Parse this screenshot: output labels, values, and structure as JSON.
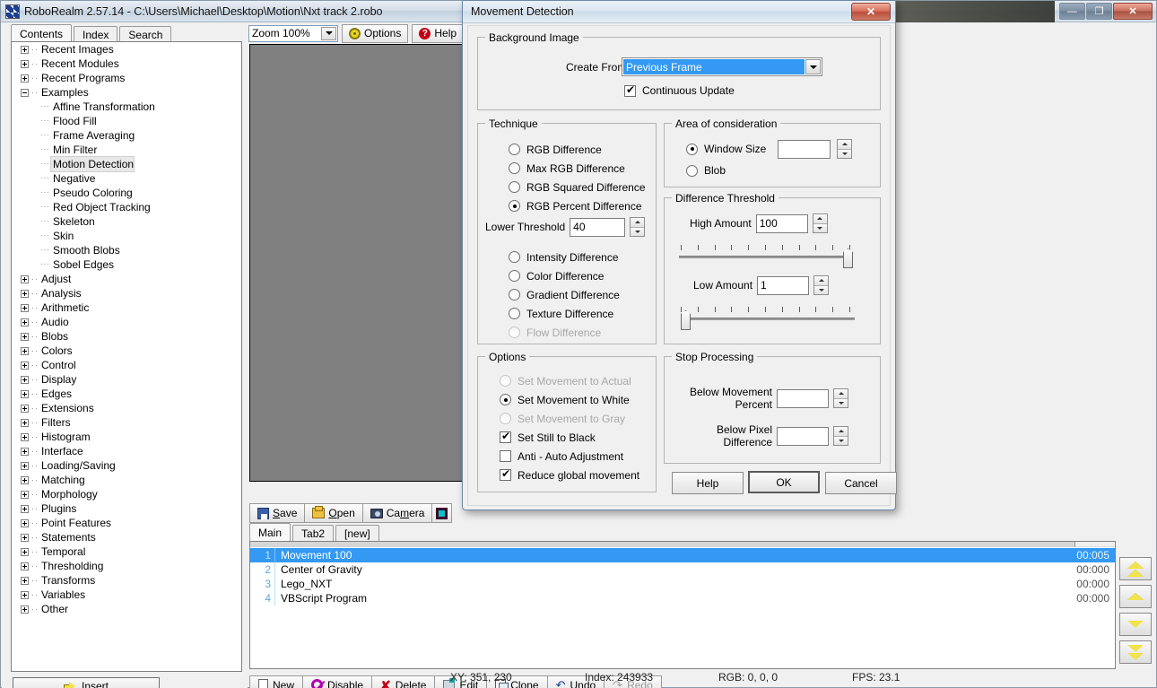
{
  "app": {
    "title": "RoboRealm 2.57.14 - C:\\Users\\Michael\\Desktop\\Motion\\Nxt track 2.robo",
    "window_controls": {
      "minimize": "—",
      "maximize": "❐",
      "close": "✕"
    }
  },
  "sidebar": {
    "tabs": [
      {
        "label": "Contents",
        "active": true
      },
      {
        "label": "Index",
        "active": false
      },
      {
        "label": "Search",
        "active": false
      }
    ],
    "tree": [
      {
        "label": "Recent Images",
        "type": "branch",
        "expanded": false
      },
      {
        "label": "Recent Modules",
        "type": "branch",
        "expanded": false
      },
      {
        "label": "Recent Programs",
        "type": "branch",
        "expanded": false
      },
      {
        "label": "Examples",
        "type": "branch",
        "expanded": true
      },
      {
        "label": "Affine Transformation",
        "type": "leaf"
      },
      {
        "label": "Flood Fill",
        "type": "leaf"
      },
      {
        "label": "Frame Averaging",
        "type": "leaf"
      },
      {
        "label": "Min Filter",
        "type": "leaf"
      },
      {
        "label": "Motion Detection",
        "type": "leaf",
        "selected": true
      },
      {
        "label": "Negative",
        "type": "leaf"
      },
      {
        "label": "Pseudo Coloring",
        "type": "leaf"
      },
      {
        "label": "Red Object Tracking",
        "type": "leaf"
      },
      {
        "label": "Skeleton",
        "type": "leaf"
      },
      {
        "label": "Skin",
        "type": "leaf"
      },
      {
        "label": "Smooth Blobs",
        "type": "leaf"
      },
      {
        "label": "Sobel Edges",
        "type": "leaf"
      },
      {
        "label": "Adjust",
        "type": "branch",
        "expanded": false
      },
      {
        "label": "Analysis",
        "type": "branch",
        "expanded": false
      },
      {
        "label": "Arithmetic",
        "type": "branch",
        "expanded": false
      },
      {
        "label": "Audio",
        "type": "branch",
        "expanded": false
      },
      {
        "label": "Blobs",
        "type": "branch",
        "expanded": false
      },
      {
        "label": "Colors",
        "type": "branch",
        "expanded": false
      },
      {
        "label": "Control",
        "type": "branch",
        "expanded": false
      },
      {
        "label": "Display",
        "type": "branch",
        "expanded": false
      },
      {
        "label": "Edges",
        "type": "branch",
        "expanded": false
      },
      {
        "label": "Extensions",
        "type": "branch",
        "expanded": false
      },
      {
        "label": "Filters",
        "type": "branch",
        "expanded": false
      },
      {
        "label": "Histogram",
        "type": "branch",
        "expanded": false
      },
      {
        "label": "Interface",
        "type": "branch",
        "expanded": false
      },
      {
        "label": "Loading/Saving",
        "type": "branch",
        "expanded": false
      },
      {
        "label": "Matching",
        "type": "branch",
        "expanded": false
      },
      {
        "label": "Morphology",
        "type": "branch",
        "expanded": false
      },
      {
        "label": "Plugins",
        "type": "branch",
        "expanded": false
      },
      {
        "label": "Point Features",
        "type": "branch",
        "expanded": false
      },
      {
        "label": "Statements",
        "type": "branch",
        "expanded": false
      },
      {
        "label": "Temporal",
        "type": "branch",
        "expanded": false
      },
      {
        "label": "Thresholding",
        "type": "branch",
        "expanded": false
      },
      {
        "label": "Transforms",
        "type": "branch",
        "expanded": false
      },
      {
        "label": "Variables",
        "type": "branch",
        "expanded": false
      },
      {
        "label": "Other",
        "type": "branch",
        "expanded": false
      }
    ],
    "insert_button": "Insert"
  },
  "viewer_toolbar": {
    "zoom_value": "Zoom 100%",
    "options_label": "Options",
    "help_label": "Help"
  },
  "file_toolbar": {
    "buttons": [
      {
        "label": "Save",
        "accel": "S"
      },
      {
        "label": "Open",
        "accel": "O"
      },
      {
        "label": "Camera",
        "accel": "m"
      }
    ]
  },
  "pipeline": {
    "tabs": [
      {
        "label": "Main",
        "active": true
      },
      {
        "label": "Tab2",
        "active": false
      },
      {
        "label": "[new]",
        "active": false
      }
    ],
    "rows": [
      {
        "index": "1",
        "name": "Movement 100",
        "time": "00:005",
        "selected": true
      },
      {
        "index": "2",
        "name": "Center of Gravity",
        "time": "00:000",
        "selected": false
      },
      {
        "index": "3",
        "name": "Lego_NXT",
        "time": "00:000",
        "selected": false
      },
      {
        "index": "4",
        "name": "VBScript Program",
        "time": "00:000",
        "selected": false
      }
    ],
    "scroll_buttons": [
      "move-to-top",
      "move-up",
      "move-down",
      "move-to-bottom"
    ]
  },
  "edit_toolbar": {
    "buttons": [
      {
        "label": "New",
        "disabled": false
      },
      {
        "label": "Disable",
        "disabled": false
      },
      {
        "label": "Delete",
        "disabled": false
      },
      {
        "label": "Edit",
        "disabled": false
      },
      {
        "label": "Clone",
        "disabled": false
      },
      {
        "label": "Undo",
        "disabled": false
      },
      {
        "label": "Redo",
        "disabled": true
      }
    ]
  },
  "status_bar": {
    "xy": "XY: 351, 230",
    "index": "Index: 243933",
    "rgb": "RGB: 0, 0, 0",
    "fps": "FPS: 23.1"
  },
  "dialog": {
    "title": "Movement Detection",
    "close_label": "✕",
    "background_image": {
      "group_title": "Background Image",
      "create_from_label": "Create From",
      "create_from_value": "Previous Frame",
      "continuous_update_label": "Continuous Update",
      "continuous_update_checked": true
    },
    "technique": {
      "group_title": "Technique",
      "options": [
        {
          "label": "RGB Difference",
          "checked": false,
          "disabled": false
        },
        {
          "label": "Max RGB Difference",
          "checked": false,
          "disabled": false
        },
        {
          "label": "RGB Squared Difference",
          "checked": false,
          "disabled": false
        },
        {
          "label": "RGB Percent Difference",
          "checked": true,
          "disabled": false
        }
      ],
      "lower_threshold_label": "Lower Threshold",
      "lower_threshold_value": "40",
      "options2": [
        {
          "label": "Intensity Difference",
          "checked": false,
          "disabled": false
        },
        {
          "label": "Color Difference",
          "checked": false,
          "disabled": false
        },
        {
          "label": "Gradient Difference",
          "checked": false,
          "disabled": false
        },
        {
          "label": "Texture Difference",
          "checked": false,
          "disabled": false
        },
        {
          "label": "Flow Difference",
          "checked": false,
          "disabled": true
        }
      ]
    },
    "area": {
      "group_title": "Area of consideration",
      "window_size_label": "Window Size",
      "window_size_value": "",
      "window_size_checked": true,
      "blob_label": "Blob",
      "blob_checked": false
    },
    "difference_threshold": {
      "group_title": "Difference Threshold",
      "high_label": "High Amount",
      "high_value": "100",
      "high_slider_percent": 100,
      "low_label": "Low Amount",
      "low_value": "1",
      "low_slider_percent": 1,
      "tick_count": 11
    },
    "options": {
      "group_title": "Options",
      "items": [
        {
          "kind": "radio",
          "label": "Set Movement to Actual",
          "checked": false,
          "disabled": true
        },
        {
          "kind": "radio",
          "label": "Set Movement to White",
          "checked": true,
          "disabled": false
        },
        {
          "kind": "radio",
          "label": "Set Movement to Gray",
          "checked": false,
          "disabled": true
        },
        {
          "kind": "check",
          "label": "Set Still to Black",
          "checked": true,
          "disabled": false
        },
        {
          "kind": "check",
          "label": "Anti - Auto Adjustment",
          "checked": false,
          "disabled": false
        },
        {
          "kind": "check",
          "label": "Reduce global movement",
          "checked": true,
          "disabled": false
        }
      ]
    },
    "stop_processing": {
      "group_title": "Stop Processing",
      "below_movement_label_1": "Below Movement",
      "below_movement_label_2": "Percent",
      "below_movement_value": "",
      "below_pixel_label_1": "Below Pixel",
      "below_pixel_label_2": "Difference",
      "below_pixel_value": ""
    },
    "buttons": {
      "help": "Help",
      "ok": "OK",
      "cancel": "Cancel"
    }
  }
}
